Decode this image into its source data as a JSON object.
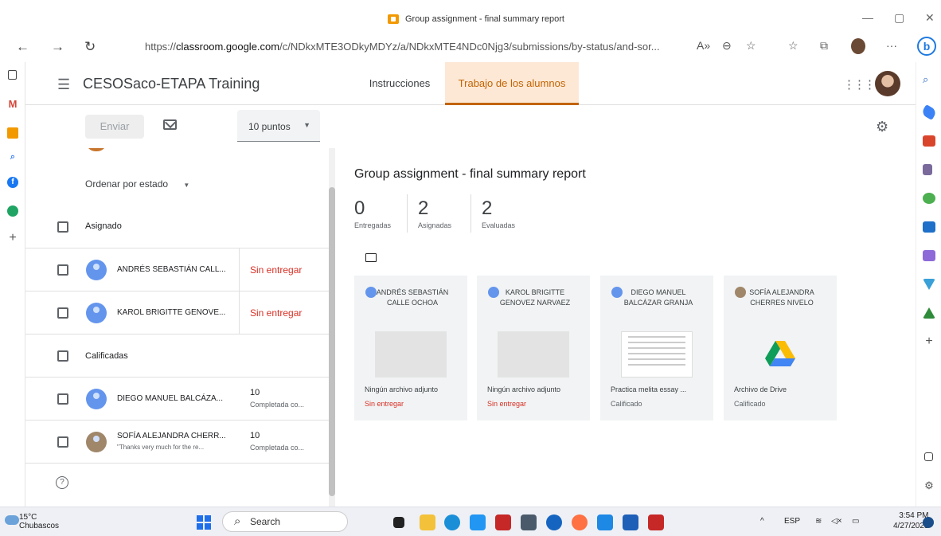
{
  "browser": {
    "window_title": "Group assignment - final summary report",
    "url_prefix": "https://",
    "url_domain": "classroom.google.com",
    "url_path": "/c/NDkxMTE3ODkyMDYz/a/NDkxMTE4NDc0Njg3/submissions/by-status/and-sor...",
    "minimize": "—",
    "restore": "▢",
    "close": "✕",
    "back": "←",
    "forward": "→",
    "reload": "↻",
    "more": "···"
  },
  "app": {
    "course": "CESOSaco-ETAPA Training",
    "tabs": [
      "Instrucciones",
      "Trabajo de los alumnos"
    ],
    "active_tab": 1
  },
  "toolbar": {
    "send_label": "Enviar",
    "points_label": "10 puntos",
    "points_caret": "▼"
  },
  "left": {
    "sort_label": "Ordenar por estado",
    "sort_caret": "▼",
    "group_assigned": "Asignado",
    "group_graded": "Calificadas",
    "students_assigned": [
      {
        "name": "ANDRÉS SEBASTIÁN CALL...",
        "status": "Sin entregar"
      },
      {
        "name": "KAROL BRIGITTE GENOVE...",
        "status": "Sin entregar"
      }
    ],
    "students_graded": [
      {
        "name": "DIEGO MANUEL BALCÁZA...",
        "grade": "10",
        "sub": "Completada co...",
        "comment": ""
      },
      {
        "name": "SOFÍA ALEJANDRA CHERR...",
        "grade": "10",
        "sub": "Completada co...",
        "comment": "\"Thanks very much for the re..."
      }
    ],
    "help": "?"
  },
  "main": {
    "title": "Group assignment - final summary report",
    "stats": [
      {
        "num": "0",
        "label": "Entregadas"
      },
      {
        "num": "2",
        "label": "Asignadas"
      },
      {
        "num": "2",
        "label": "Evaluadas"
      }
    ],
    "cards": [
      {
        "name": "ANDRÉS SEBASTIÁN CALLE OCHOA",
        "file": "Ningún archivo adjunto",
        "state": "Sin entregar"
      },
      {
        "name": "KAROL BRIGITTE GENOVEZ NARVAEZ",
        "file": "Ningún archivo adjunto",
        "state": "Sin entregar"
      },
      {
        "name": "DIEGO MANUEL BALCÁZAR GRANJA",
        "file": "Practica melita essay ...",
        "state": "Calificado"
      },
      {
        "name": "SOFÍA ALEJANDRA CHERRES NIVELO",
        "file": "Archivo de Drive",
        "state": "Calificado"
      }
    ]
  },
  "taskbar": {
    "temp": "15°C",
    "weather": "Chubascos",
    "search": "Search",
    "lang": "ESP",
    "time": "3:54 PM",
    "date": "4/27/2023",
    "caret_up": "^"
  },
  "colors": {
    "accent": "#c26401",
    "accent_bg": "#fde8d6",
    "missing": "#d93025"
  }
}
